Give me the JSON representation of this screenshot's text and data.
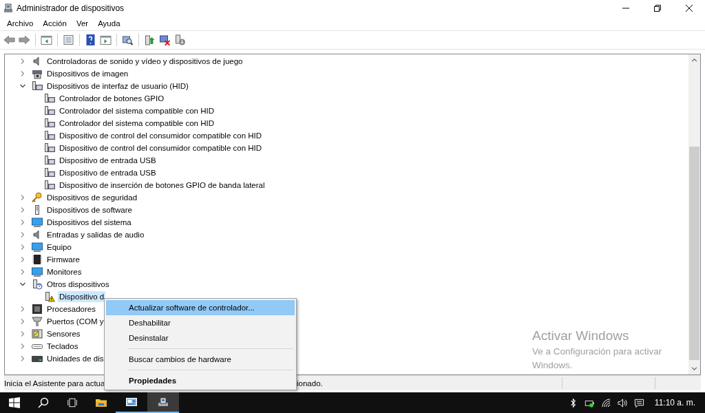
{
  "window": {
    "title": "Administrador de dispositivos"
  },
  "menu_bar": [
    "Archivo",
    "Acción",
    "Ver",
    "Ayuda"
  ],
  "tree": [
    {
      "label": "Controladoras de sonido y vídeo y dispositivos de juego",
      "kind": "speaker",
      "expanded": false,
      "selected": false
    },
    {
      "label": "Dispositivos de imagen",
      "kind": "camera",
      "expanded": false,
      "selected": false
    },
    {
      "label": "Dispositivos de interfaz de usuario (HID)",
      "kind": "hid",
      "expanded": true,
      "selected": false,
      "children": [
        {
          "label": "Controlador de botones GPIO",
          "kind": "hid",
          "selected": false
        },
        {
          "label": "Controlador del sistema compatible con HID",
          "kind": "hid",
          "selected": false
        },
        {
          "label": "Controlador del sistema compatible con HID",
          "kind": "hid",
          "selected": false
        },
        {
          "label": "Dispositivo de control del consumidor compatible con HID",
          "kind": "hid",
          "selected": false
        },
        {
          "label": "Dispositivo de control del consumidor compatible con HID",
          "kind": "hid",
          "selected": false
        },
        {
          "label": "Dispositivo de entrada USB",
          "kind": "hid",
          "selected": false
        },
        {
          "label": "Dispositivo de entrada USB",
          "kind": "hid",
          "selected": false
        },
        {
          "label": "Dispositivo de inserción de botones GPIO de banda lateral",
          "kind": "hid",
          "selected": false
        }
      ]
    },
    {
      "label": "Dispositivos de seguridad",
      "kind": "key",
      "expanded": false,
      "selected": false
    },
    {
      "label": "Dispositivos de software",
      "kind": "stick",
      "expanded": false,
      "selected": false
    },
    {
      "label": "Dispositivos del sistema",
      "kind": "monitor",
      "expanded": false,
      "selected": false
    },
    {
      "label": "Entradas y salidas de audio",
      "kind": "speaker",
      "expanded": false,
      "selected": false
    },
    {
      "label": "Equipo",
      "kind": "monitor",
      "expanded": false,
      "selected": false
    },
    {
      "label": "Firmware",
      "kind": "chip",
      "expanded": false,
      "selected": false
    },
    {
      "label": "Monitores",
      "kind": "monitor",
      "expanded": false,
      "selected": false
    },
    {
      "label": "Otros dispositivos",
      "kind": "unknown",
      "expanded": true,
      "selected": false,
      "children": [
        {
          "label": "Dispositivo d",
          "kind": "warning",
          "selected": true
        }
      ]
    },
    {
      "label": "Procesadores",
      "kind": "processor",
      "expanded": false,
      "selected": false
    },
    {
      "label": "Puertos (COM y",
      "kind": "port",
      "expanded": false,
      "selected": false
    },
    {
      "label": "Sensores",
      "kind": "sensor",
      "expanded": false,
      "selected": false
    },
    {
      "label": "Teclados",
      "kind": "keyboard",
      "expanded": false,
      "selected": false
    },
    {
      "label": "Unidades de dis",
      "kind": "disk",
      "expanded": false,
      "selected": false
    }
  ],
  "context_menu": [
    {
      "label": "Actualizar software de controlador...",
      "kind": "item",
      "selected": true
    },
    {
      "label": "Deshabilitar",
      "kind": "item",
      "selected": false
    },
    {
      "label": "Desinstalar",
      "kind": "item",
      "selected": false
    },
    {
      "kind": "separator"
    },
    {
      "label": "Buscar cambios de hardware",
      "kind": "item",
      "selected": false
    },
    {
      "kind": "separator"
    },
    {
      "label": "Propiedades",
      "kind": "default",
      "selected": false
    }
  ],
  "status_bar": {
    "left": "Inicia el Asistente para actua",
    "right": "ionado."
  },
  "activation": {
    "title": "Activar Windows",
    "text": "Ve a Configuración para activar Windows."
  },
  "taskbar": {
    "clock": "11:10 a. m."
  }
}
